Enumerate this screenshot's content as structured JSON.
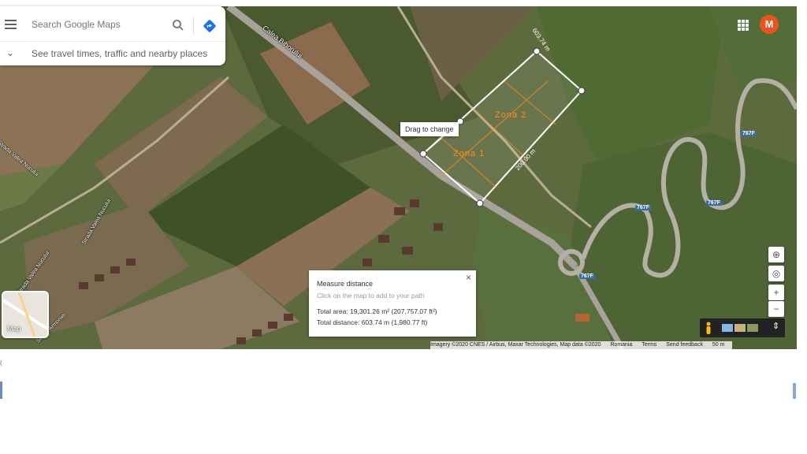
{
  "search": {
    "placeholder": "Search Google Maps"
  },
  "travel": {
    "label": "See travel times, traffic and nearby places"
  },
  "account": {
    "initial": "M"
  },
  "map": {
    "road_labels": [
      "Calea Bihorului",
      "Strada Valea Nucului",
      "Strada Valea Nucului",
      "Strada Valea Nucului",
      "Strada Armoniei"
    ],
    "highway_badges": [
      "767F",
      "767F",
      "767F",
      "767F"
    ],
    "tooltip": "Drag to change",
    "zones": [
      "Zona  1",
      "Zona  2"
    ],
    "edge_labels": [
      "603.74 m",
      "200.00 m"
    ]
  },
  "measure": {
    "title": "Measure distance",
    "hint": "Click on the map to add to your path",
    "total_area": "Total area: 19,301.26 m² (207,757.07 ft²)",
    "total_distance": "Total distance: 603.74 m (1,980.77 ft)",
    "close_glyph": "×"
  },
  "layer_tile": {
    "label": "Map"
  },
  "controls": {
    "globe": "⊕",
    "location": "◎",
    "zoom_in": "+",
    "zoom_out": "−",
    "expand": "⇕"
  },
  "footer": {
    "imagery": "Imagery ©2020 CNES / Airbus, Maxar Technologies, Map data ©2020",
    "country": "Romania",
    "terms": "Terms",
    "feedback": "Send feedback",
    "scale": "50 m"
  },
  "stray": {
    "left_mark": "("
  },
  "colors": {
    "avatar": "#e8541c",
    "zone_text": "#ff8c1a",
    "highway_badge": "#3a6ea5"
  }
}
